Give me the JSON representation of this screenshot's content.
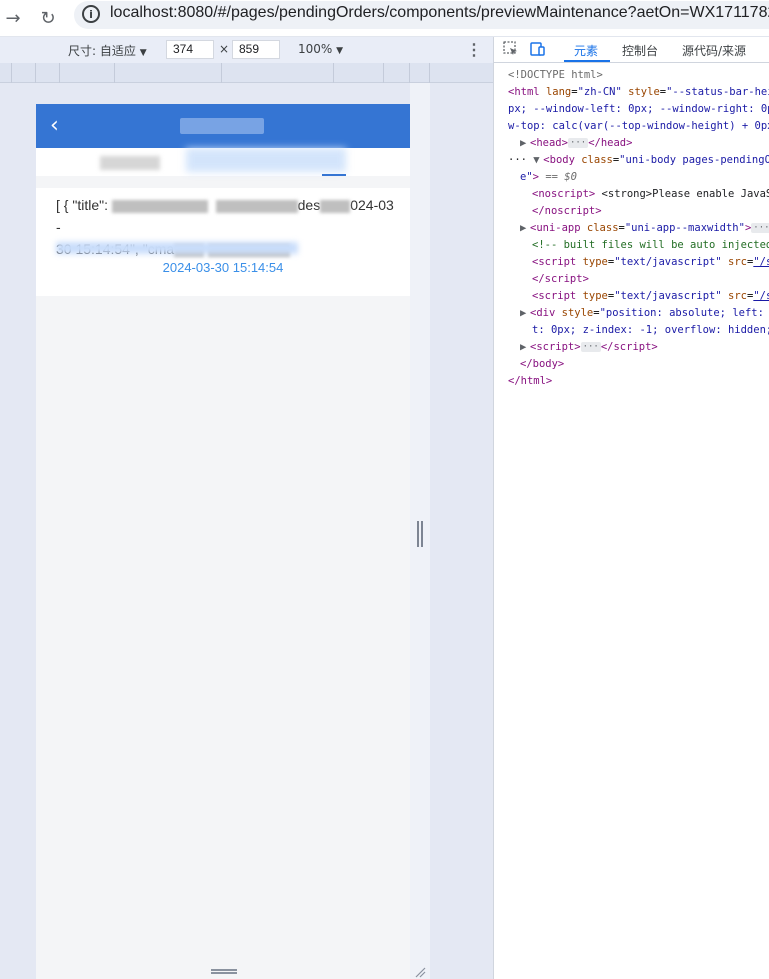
{
  "browser": {
    "back_icon": "→",
    "reload_icon": "↻",
    "info_icon": "i",
    "url": "localhost:8080/#/pages/pendingOrders/components/previewMaintenance?aetOn=WX1711782891"
  },
  "device_toolbar": {
    "dimensions_label": "尺寸: 自适应",
    "width": "374",
    "times": "×",
    "height": "859",
    "zoom": "100%",
    "dropdown_arrow": "▼",
    "kebab": "⋮"
  },
  "devtools": {
    "tabs": [
      "元素",
      "控制台",
      "源代码/来源"
    ],
    "active_tab": "元素",
    "code_lines": [
      {
        "indent": 0,
        "html": "<span class=\"tok-doc\">&lt;!DOCTYPE html&gt;</span>"
      },
      {
        "indent": 0,
        "html": "<span class=\"tok-tag\">&lt;html</span> <span class=\"tok-attr\">lang</span>=<span class=\"tok-val\">\"zh-CN\"</span> <span class=\"tok-attr\">style</span>=<span class=\"tok-val\">\"--status-bar-heigh</span>"
      },
      {
        "indent": 0,
        "html": "<span class=\"tok-val\">px; --window-left: 0px; --window-right: 0px;</span>"
      },
      {
        "indent": 0,
        "html": "<span class=\"tok-val\">w-top: calc(var(--top-window-height) + 0px);</span>"
      },
      {
        "indent": 1,
        "html": "<span class=\"tri\">▶</span><span class=\"tok-tag\">&lt;head&gt;</span><span class=\"ellipsis\">···</span><span class=\"tok-tag\">&lt;/head&gt;</span>"
      },
      {
        "indent": 0,
        "html": "<span class=\"tok-txt\">··· </span><span class=\"tri\">▼</span><span class=\"tok-tag\">&lt;body</span> <span class=\"tok-attr\">class</span>=<span class=\"tok-val\">\"uni-body pages-pendingOrders-</span>"
      },
      {
        "indent": 1,
        "html": "<span class=\"tok-val\">e\"</span><span class=\"tok-tag\">&gt;</span> <span class=\"dollar\">== $0</span>"
      },
      {
        "indent": 2,
        "html": "<span class=\"tok-tag\">&lt;noscript&gt;</span> <span class=\"tok-txt\">&lt;strong&gt;Please enable JavaScr</span>"
      },
      {
        "indent": 2,
        "html": "<span class=\"tok-tag\">&lt;/noscript&gt;</span>"
      },
      {
        "indent": 1,
        "html": "<span class=\"tri\">▶</span><span class=\"tok-tag\">&lt;uni-app</span> <span class=\"tok-attr\">class</span>=<span class=\"tok-val\">\"uni-app--maxwidth\"</span><span class=\"tok-tag\">&gt;</span><span class=\"ellipsis\">···</span><span class=\"tok-tag\">&lt;/</span>"
      },
      {
        "indent": 2,
        "html": "<span class=\"tok-cmt\">&lt;!-- built files will be auto injected --</span>"
      },
      {
        "indent": 2,
        "html": "<span class=\"tok-tag\">&lt;script</span> <span class=\"tok-attr\">type</span>=<span class=\"tok-val\">\"text/javascript\"</span> <span class=\"tok-attr\">src</span>=<span class=\"tok-link\">\"/sta</span>"
      },
      {
        "indent": 2,
        "html": "<span class=\"tok-tag\">&lt;/script&gt;</span>"
      },
      {
        "indent": 2,
        "html": "<span class=\"tok-tag\">&lt;script</span> <span class=\"tok-attr\">type</span>=<span class=\"tok-val\">\"text/javascript\"</span> <span class=\"tok-attr\">src</span>=<span class=\"tok-link\">\"/sta</span>"
      },
      {
        "indent": 1,
        "html": "<span class=\"tri\">▶</span><span class=\"tok-tag\">&lt;div</span> <span class=\"tok-attr\">style</span>=<span class=\"tok-val\">\"position: absolute; left: 0p</span>"
      },
      {
        "indent": 2,
        "html": "<span class=\"tok-val\">t: 0px; z-index: -1; overflow: hidden; v</span>"
      },
      {
        "indent": 1,
        "html": "<span class=\"tri\">▶</span><span class=\"tok-tag\">&lt;script&gt;</span><span class=\"ellipsis\">···</span><span class=\"tok-tag\">&lt;/script&gt;</span>"
      },
      {
        "indent": 1,
        "html": "<span class=\"tok-tag\">&lt;/body&gt;</span>"
      },
      {
        "indent": 0,
        "html": "<span class=\"tok-tag\">&lt;/html&gt;</span>"
      }
    ]
  },
  "app": {
    "back_icon": "‹",
    "card": {
      "line1_prefix": "[ { \"title\": ",
      "line1_mid": "des",
      "line1_suffix": "024-03-",
      "line2_prefix": "30 15:14:54\", \"",
      "line2_mid": "cma",
      "line2_suffix": "",
      "date": "2024-03-30 15:14:54"
    }
  },
  "colors": {
    "nav_blue": "#3575d3",
    "date_blue": "#3a8fe8",
    "active_tab": "#1a73e8"
  }
}
